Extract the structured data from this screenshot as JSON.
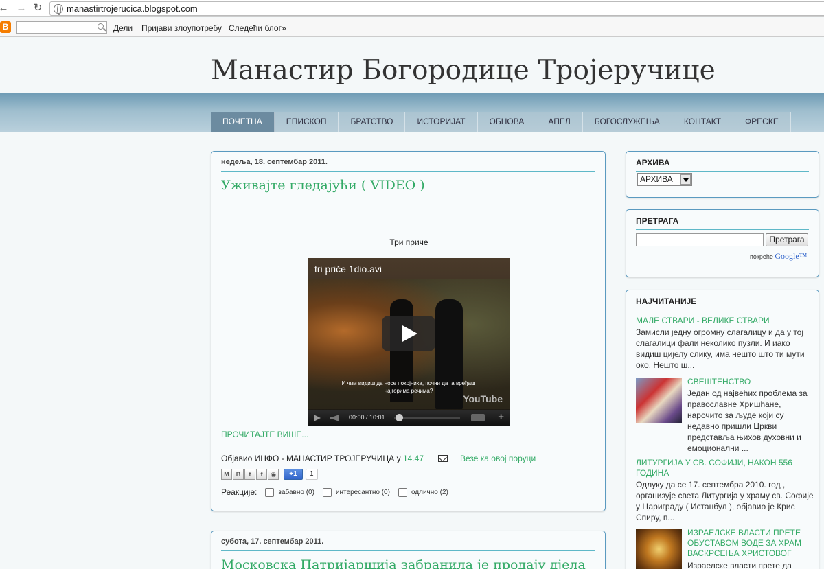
{
  "browser": {
    "url": "manastirtrojerucica.blogspot.com"
  },
  "blogger_bar": {
    "share": "Дели",
    "report": "Пријави злоупотребу",
    "next": "Следећи блог»"
  },
  "site": {
    "title": "Манастир Богородице Тројеручице"
  },
  "menu": [
    "ПОЧЕТНА",
    "ЕПИСКОП",
    "БРАТСТВО",
    "ИСТОРИЈАТ",
    "ОБНОВА",
    "АПЕЛ",
    "БОГОСЛУЖЕЊА",
    "КОНТАКТ",
    "ФРЕСКЕ"
  ],
  "post1": {
    "date": "недеља, 18. септембар 2011.",
    "title": "Уживајте гледајући ( VIDEO )",
    "video_caption": "Три приче",
    "video_title": "tri priče 1dio.avi",
    "subtitle_line1": "И чим видиш да носе покојника, почни да га вређаш",
    "subtitle_line2": "најгорима речима?",
    "video_logo": "YouTube",
    "time_display": "00:00 / 10:01",
    "read_more": "ПРОЧИТАЈТЕ ВИШЕ...",
    "posted_by": "Објавио ИНФО - МАНАСТИР ТРОЈЕРУЧИЦА у",
    "posted_time": "14.47",
    "backlinks": "Везе ка овој поруци",
    "plusone": "+1",
    "plusone_count": "1",
    "reactions_label": "Реакције:",
    "reactions": [
      "забавно (0)",
      "интересантно (0)",
      "одлично (2)"
    ]
  },
  "post2": {
    "date": "субота, 17. септембар 2011.",
    "title": "Московска Патријаршија забранила је продају дјела"
  },
  "sidebar": {
    "archive": {
      "title": "АРХИВА",
      "selected": "АРХИВА"
    },
    "search": {
      "title": "ПРЕТРАГА",
      "button": "Претрага",
      "powered": "покреће",
      "google": "Google™"
    },
    "popular": {
      "title": "НАЈЧИТАНИЈЕ",
      "items": [
        {
          "title": "МАЛЕ СТВАРИ - ВЕЛИКЕ СТВАРИ",
          "snippet": "Замисли једну огромну слагалицу и да у тој слагалици фали неколико пузли. И иако видиш цијелу слику, има нешто што ти мути око. Нешто ш..."
        },
        {
          "title": "СВЕШТЕНСТВО",
          "snippet": "Један од највећих проблема за православне Хришћане, нарочито за људе који су недавно пришли Цркви представља њихов духовни и емоционални ..."
        },
        {
          "title": "ЛИТУРГИЈА У СВ. СОФИЈИ, НАКОН 556 ГОДИНА",
          "snippet": "Одлуку да се 17. септембра 2010. год , организује света Литургија у храму св. Софије у Цариграду ( Истанбул ), објавио је Крис Спиру, п..."
        },
        {
          "title": "ИЗРАЕЛСКЕ ВЛАСТИ ПРЕТЕ ОБУСТАВОМ ВОДЕ ЗА ХРАМ ВАСКРСЕЊА ХРИСТОВОГ",
          "snippet": "Израелске власти прете да"
        }
      ]
    }
  }
}
